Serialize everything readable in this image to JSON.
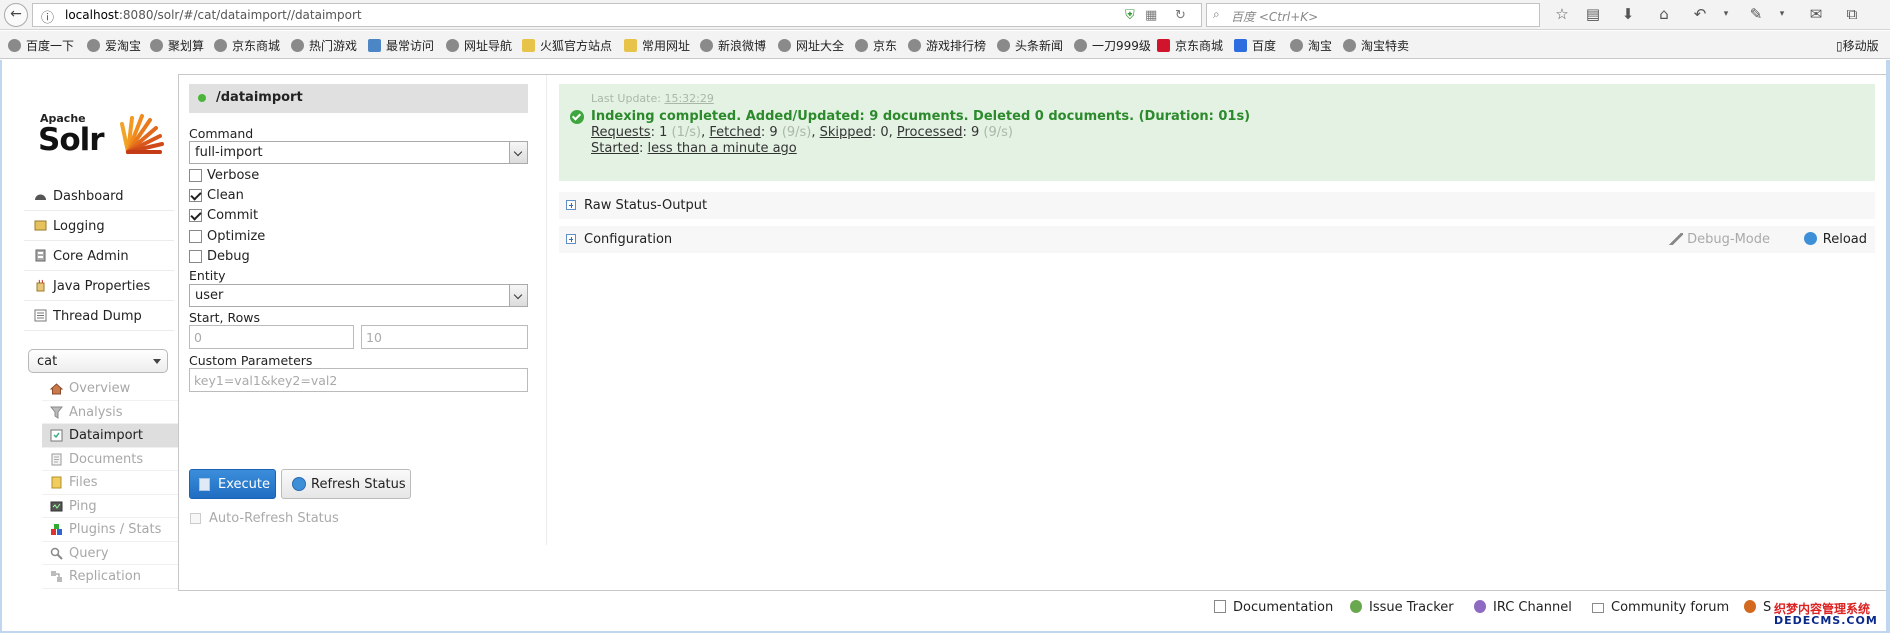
{
  "browser": {
    "url_host": "localhost",
    "url_rest": ":8080/solr/#/cat/dataimport//dataimport",
    "search_placeholder": "百度 <Ctrl+K>",
    "bookmarks": [
      {
        "label": "百度一下",
        "icon": "globe-icon"
      },
      {
        "label": "爱淘宝",
        "icon": "globe-icon"
      },
      {
        "label": "聚划算",
        "icon": "globe-icon"
      },
      {
        "label": "京东商城",
        "icon": "globe-icon"
      },
      {
        "label": "热门游戏",
        "icon": "globe-icon"
      },
      {
        "label": "最常访问",
        "icon": "page-icon"
      },
      {
        "label": "网址导航",
        "icon": "globe-icon"
      },
      {
        "label": "火狐官方站点",
        "icon": "folder-icon"
      },
      {
        "label": "常用网址",
        "icon": "folder-icon"
      },
      {
        "label": "新浪微博",
        "icon": "globe-icon"
      },
      {
        "label": "网址大全",
        "icon": "globe-icon"
      },
      {
        "label": "京东",
        "icon": "globe-icon"
      },
      {
        "label": "游戏排行榜",
        "icon": "globe-icon"
      },
      {
        "label": "头条新闻",
        "icon": "globe-icon"
      },
      {
        "label": "一刀999级",
        "icon": "globe-icon"
      },
      {
        "label": "京东商城",
        "icon": "jd-icon"
      },
      {
        "label": "百度",
        "icon": "baidu-icon"
      },
      {
        "label": "淘宝",
        "icon": "globe-icon"
      },
      {
        "label": "淘宝特卖",
        "icon": "globe-icon"
      }
    ],
    "mobile_bookmarks": "移动版"
  },
  "logo": {
    "apache": "Apache",
    "solr": "Solr"
  },
  "nav": {
    "items": [
      {
        "label": "Dashboard",
        "icon": "dashboard-icon"
      },
      {
        "label": "Logging",
        "icon": "logging-icon"
      },
      {
        "label": "Core Admin",
        "icon": "core-admin-icon"
      },
      {
        "label": "Java Properties",
        "icon": "java-icon"
      },
      {
        "label": "Thread Dump",
        "icon": "thread-dump-icon"
      }
    ],
    "core_selected": "cat",
    "core_items": [
      {
        "label": "Overview",
        "icon": "home-icon"
      },
      {
        "label": "Analysis",
        "icon": "funnel-icon"
      },
      {
        "label": "Dataimport",
        "icon": "dataimport-icon"
      },
      {
        "label": "Documents",
        "icon": "documents-icon"
      },
      {
        "label": "Files",
        "icon": "folder-icon"
      },
      {
        "label": "Ping",
        "icon": "ping-icon"
      },
      {
        "label": "Plugins / Stats",
        "icon": "plugins-icon"
      },
      {
        "label": "Query",
        "icon": "search-icon"
      },
      {
        "label": "Replication",
        "icon": "replication-icon"
      }
    ]
  },
  "form": {
    "handler": "/dataimport",
    "command_label": "Command",
    "command_value": "full-import",
    "options": [
      {
        "label": "Verbose",
        "checked": false
      },
      {
        "label": "Clean",
        "checked": true
      },
      {
        "label": "Commit",
        "checked": true
      },
      {
        "label": "Optimize",
        "checked": false
      },
      {
        "label": "Debug",
        "checked": false
      }
    ],
    "entity_label": "Entity",
    "entity_value": "user",
    "start_rows_label": "Start, Rows",
    "start_placeholder": "0",
    "rows_placeholder": "10",
    "custom_params_label": "Custom Parameters",
    "custom_params_placeholder": "key1=val1&key2=val2",
    "execute_label": "Execute",
    "refresh_label": "Refresh Status",
    "auto_refresh_label": "Auto-Refresh Status"
  },
  "status": {
    "last_update_label": "Last Update:",
    "last_update_time": "15:32:29",
    "headline": "Indexing completed. Added/Updated: 9 documents. Deleted 0 documents. (Duration: 01s)",
    "requests_label": "Requests",
    "requests_value": ": 1",
    "requests_rate": "(1/s)",
    "fetched_label": "Fetched",
    "fetched_value": ": 9",
    "fetched_rate": "(9/s)",
    "skipped_label": "Skipped",
    "skipped_value": ": 0,",
    "processed_label": "Processed",
    "processed_value": ": 9",
    "processed_rate": "(9/s)",
    "started_label": "Started",
    "started_value": "less than a minute ago"
  },
  "sections": {
    "raw_status": "Raw Status-Output",
    "configuration": "Configuration",
    "debug_mode": "Debug-Mode",
    "reload": "Reload"
  },
  "footer": {
    "links": [
      {
        "label": "Documentation",
        "icon": "documentation-icon"
      },
      {
        "label": "Issue Tracker",
        "icon": "bug-icon"
      },
      {
        "label": "IRC Channel",
        "icon": "irc-icon"
      },
      {
        "label": "Community forum",
        "icon": "mail-icon"
      },
      {
        "label": "So",
        "icon": "solr-icon"
      }
    ]
  },
  "watermark": {
    "line1": "织梦内容管理系统",
    "line2": "DEDECMS.COM"
  }
}
